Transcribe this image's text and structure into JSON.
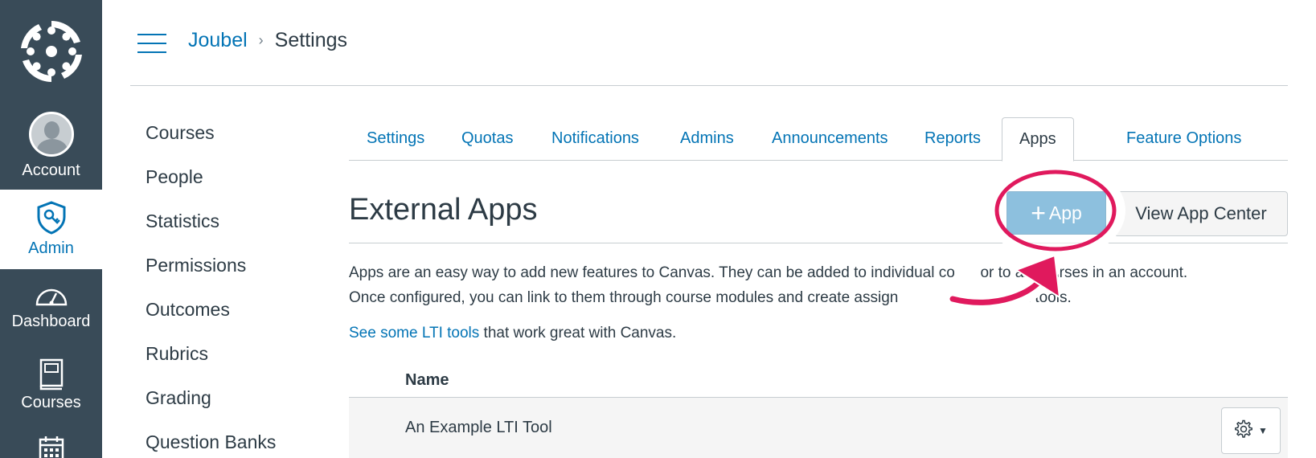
{
  "global_nav": {
    "account_label": "Account",
    "admin_label": "Admin",
    "dashboard_label": "Dashboard",
    "courses_label": "Courses"
  },
  "breadcrumb": {
    "parent": "Joubel",
    "current": "Settings"
  },
  "left_menu": {
    "items": [
      {
        "label": "Courses"
      },
      {
        "label": "People"
      },
      {
        "label": "Statistics"
      },
      {
        "label": "Permissions"
      },
      {
        "label": "Outcomes"
      },
      {
        "label": "Rubrics"
      },
      {
        "label": "Grading"
      },
      {
        "label": "Question Banks"
      }
    ]
  },
  "tabs": [
    {
      "label": "Settings",
      "active": false
    },
    {
      "label": "Quotas",
      "active": false
    },
    {
      "label": "Notifications",
      "active": false
    },
    {
      "label": "Admins",
      "active": false
    },
    {
      "label": "Announcements",
      "active": false
    },
    {
      "label": "Reports",
      "active": false
    },
    {
      "label": "Apps",
      "active": true
    },
    {
      "label": "Feature Options",
      "active": false
    }
  ],
  "main": {
    "title": "External Apps",
    "add_app_label": "App",
    "view_app_center_label": "View App Center",
    "description_line1": "Apps are an easy way to add new features to Canvas. They can be added to individual co      or to all courses in an account.",
    "description_line2": "Once configured, you can link to them through course modules and create assign              ssessment tools.",
    "lti_link": "See some LTI tools",
    "lti_rest": " that work great with Canvas.",
    "table": {
      "column_name": "Name",
      "rows": [
        {
          "name": "An Example LTI Tool"
        }
      ]
    }
  },
  "colors": {
    "nav_bg": "#394b58",
    "link": "#0374b5",
    "annotation": "#e0195d"
  }
}
